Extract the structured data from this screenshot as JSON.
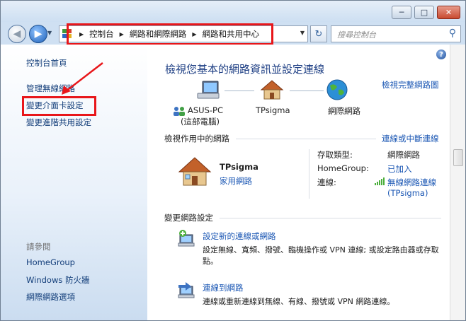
{
  "window": {
    "min_glyph": "─",
    "max_glyph": "□",
    "close_glyph": "✕"
  },
  "nav": {
    "back_glyph": "◀",
    "forward_glyph": "▶",
    "dropdown_glyph": "▼",
    "refresh_glyph": "↻",
    "breadcrumbs": [
      "控制台",
      "網路和網際網路",
      "網路和共用中心"
    ],
    "crumb_separator": "▶",
    "search_placeholder": "搜尋控制台",
    "search_glyph": "⚲"
  },
  "sidebar": {
    "home": "控制台首頁",
    "links": [
      "管理無線網路",
      "變更介面卡設定",
      "變更進階共用設定"
    ],
    "see_also_header": "請參閱",
    "see_also": [
      "HomeGroup",
      "Windows 防火牆",
      "網際網路選項"
    ]
  },
  "main": {
    "help_glyph": "?",
    "heading": "檢視您基本的網路資訊並設定連線",
    "full_map_link": "檢視完整網路圖",
    "map_nodes": {
      "computer": "ASUS-PC",
      "computer_sub": "(這部電腦)",
      "network": "TPsigma",
      "internet": "網際網路"
    },
    "active_networks": {
      "title": "檢視作用中的網路",
      "connect_link": "連線或中斷連線",
      "network_name": "TPsigma",
      "network_type": "家用網路",
      "access_type_label": "存取類型:",
      "access_type_value": "網際網路",
      "homegroup_label": "HomeGroup:",
      "homegroup_value": "已加入",
      "connections_label": "連線:",
      "connection_value": "無線網路連線",
      "connection_ssid": "(TPsigma)"
    },
    "change_settings": {
      "title": "變更網路設定",
      "tasks": [
        {
          "link": "設定新的連線或網路",
          "desc": "設定無線、寬頻、撥號、臨機操作或 VPN 連線; 或設定路由器或存取點。"
        },
        {
          "link": "連線到網路",
          "desc": "連線或重新連線到無線、有線、撥號或 VPN 網路連線。"
        }
      ]
    }
  },
  "colors": {
    "highlight_red": "#e8161a",
    "link_blue": "#1b57b4",
    "heading_blue": "#1e3f84"
  }
}
